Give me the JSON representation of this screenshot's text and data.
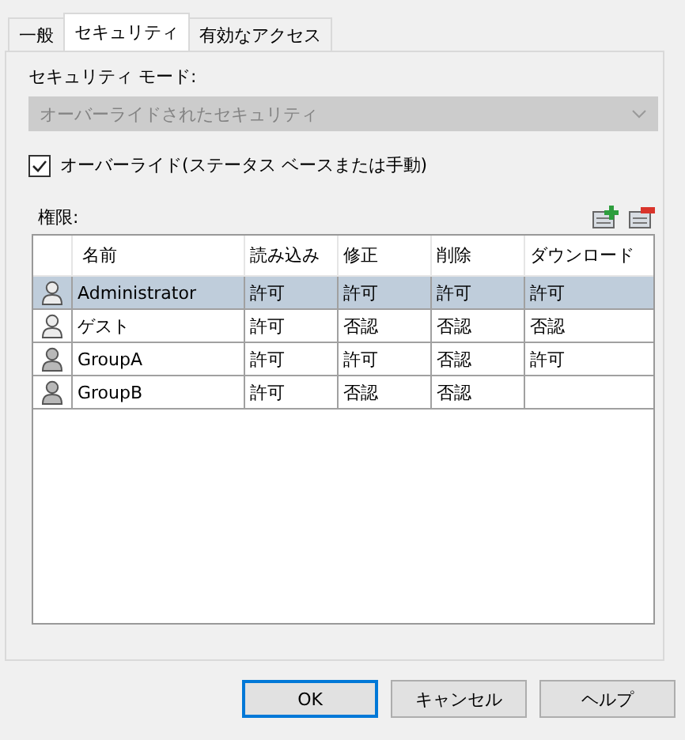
{
  "tabs": [
    {
      "label": "一般",
      "selected": false
    },
    {
      "label": "セキュリティ",
      "selected": true
    },
    {
      "label": "有効なアクセス",
      "selected": false
    }
  ],
  "security_mode": {
    "label": "セキュリティ モード:",
    "value": "オーバーライドされたセキュリティ",
    "disabled": true
  },
  "override": {
    "label": "オーバーライド(ステータス ベースまたは手動)",
    "checked": true
  },
  "permissions": {
    "label": "権限:",
    "columns": [
      "名前",
      "読み込み",
      "修正",
      "削除",
      "ダウンロード"
    ],
    "rows": [
      {
        "kind": "user",
        "selected": true,
        "cells": [
          "Administrator",
          "許可",
          "許可",
          "許可",
          "許可"
        ]
      },
      {
        "kind": "user",
        "selected": false,
        "cells": [
          "ゲスト",
          "許可",
          "否認",
          "否認",
          "否認"
        ]
      },
      {
        "kind": "group",
        "selected": false,
        "cells": [
          "GroupA",
          "許可",
          "許可",
          "否認",
          "許可"
        ]
      },
      {
        "kind": "group",
        "selected": false,
        "cells": [
          "GroupB",
          "許可",
          "否認",
          "否認",
          null
        ]
      }
    ]
  },
  "buttons": [
    {
      "label": "OK",
      "default": true
    },
    {
      "label": "キャンセル",
      "default": false
    },
    {
      "label": "ヘルプ",
      "default": false
    }
  ]
}
